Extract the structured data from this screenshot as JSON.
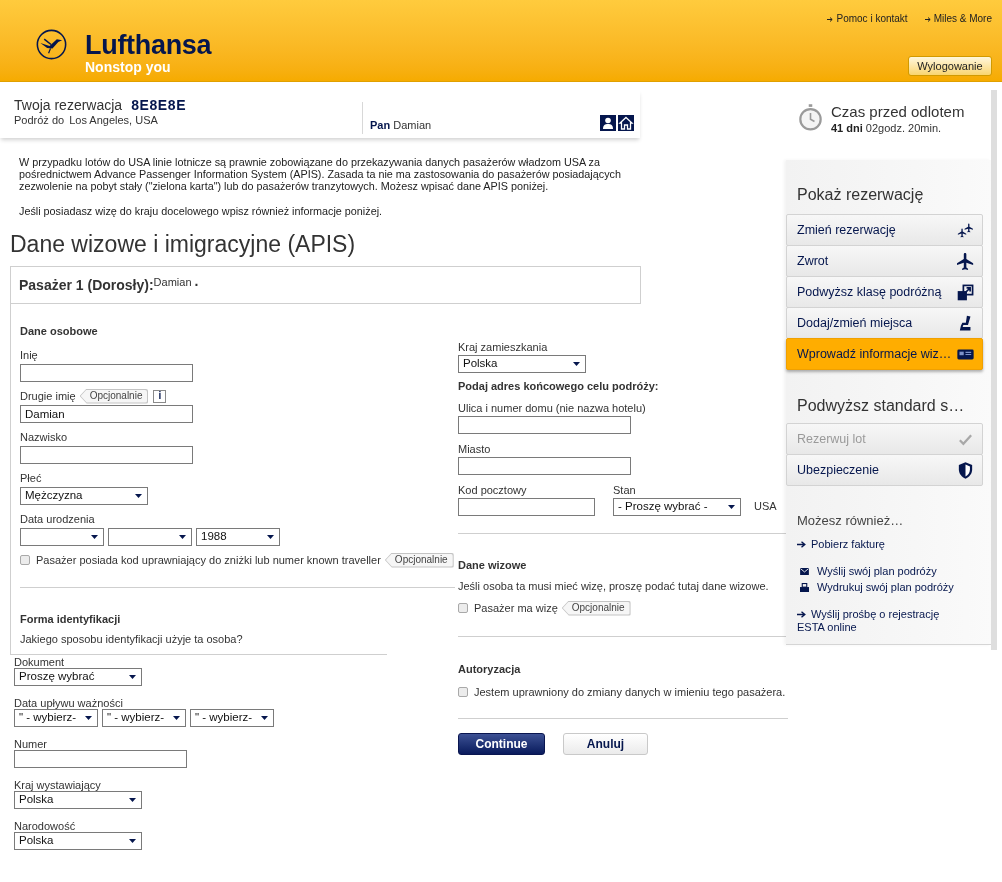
{
  "header": {
    "brand": "Lufthansa",
    "slogan": "Nonstop you",
    "links": [
      "Pomoc i kontakt",
      "Miles & More"
    ],
    "logout_button": "Wylogowanie"
  },
  "reservation": {
    "label": "Twoja rezerwacja",
    "code": "8E8E8E",
    "destination_label": "Podróż do",
    "destination": "Los Angeles, USA",
    "passenger": "**Pan** Damian"
  },
  "countdown": {
    "title": "Czas przed odlotem",
    "remaining": "**41 dni** 02godz. 20min."
  },
  "intro": [
    "W przypadku lotów do USA linie lotnicze są prawnie zobowiązane do przekazywania danych pasażerów władzom USA za pośrednictwem Advance Passenger Information System (APIS). Zasada ta nie ma zastosowania do pasażerów posiadających zezwolenie na pobyt stały (\"zielona karta\") lub do pasażerów tranzytowych. Możesz wpisać dane APIS poniżej.",
    "Jeśli posiadasz wizę do kraju docelowego wpisz również informacje poniżej."
  ],
  "page_title": "Dane wizowe i imigracyjne (APIS)",
  "passenger_panel": {
    "title": "Pasażer 1 (Dorosły):",
    "name": "Damian **.**",
    "personal": {
      "heading": "Dane osobowe",
      "fields": [
        {
          "kind": "text",
          "label": "Inię"
        },
        {
          "kind": "text",
          "label": "Drugie imię",
          "tag": "Opcjonalnie",
          "info": "i",
          "value": "Damian"
        },
        {
          "kind": "text",
          "label": "Nazwisko"
        },
        {
          "kind": "select",
          "label": "Płeć",
          "value": "Mężczyzna"
        },
        {
          "kind": "date",
          "label": "Data urodzenia",
          "parts": [
            {
              "kind": "select"
            },
            {
              "kind": "select"
            },
            {
              "kind": "select",
              "value": "1988"
            }
          ]
        }
      ],
      "checkbox": {
        "label": "Pasażer posiada kod uprawniający do zniżki lub numer known traveller",
        "checked": false,
        "tag": "Opcjonalnie"
      }
    },
    "identification": {
      "heading": "Forma identyfikacji",
      "question": "Jakiego sposobu identyfikacji użyje ta osoba?",
      "fields": [
        {
          "kind": "select",
          "label": "Dokument",
          "value": "Proszę wybrać"
        },
        {
          "kind": "date",
          "label": "Data upływu ważności",
          "parts": [
            {
              "kind": "select",
              "value": "\" - wybierz-"
            },
            {
              "kind": "select",
              "value": "\" - wybierz-"
            },
            {
              "kind": "select",
              "value": "\" - wybierz-"
            }
          ]
        },
        {
          "kind": "text",
          "label": "Numer"
        },
        {
          "kind": "select",
          "label": "Kraj wystawiający",
          "value": "Polska"
        },
        {
          "kind": "select",
          "label": "Narodowość",
          "value": "Polska"
        }
      ]
    },
    "residence": {
      "kind": "select",
      "label": "Kraj zamieszkania",
      "value": "Polska"
    },
    "address": {
      "heading": "Podaj adres końcowego celu podróży:",
      "fields": [
        {
          "kind": "text",
          "label": "Ulica i numer domu (nie nazwa hotelu)"
        },
        {
          "kind": "text",
          "label": "Miasto"
        }
      ],
      "postal": {
        "kind": "text",
        "label": "Kod pocztowy"
      },
      "state": {
        "kind": "select",
        "label": "Stan",
        "value": "- Proszę wybrać -"
      },
      "country": "USA"
    },
    "visa": {
      "heading": "Dane wizowe",
      "text": "Jeśli osoba ta musi mieć wizę, proszę podać tutaj dane wizowe.",
      "checkbox": {
        "label": "Pasażer ma wizę",
        "checked": false,
        "tag": "Opcjonalnie"
      }
    },
    "authorization": {
      "heading": "Autoryzacja",
      "checkbox": {
        "label": "Jestem uprawniony do zmiany danych w imieniu tego pasażera.",
        "checked": false
      }
    },
    "buttons": [
      {
        "kind": "primary",
        "label": "Continue"
      },
      {
        "kind": "secondary",
        "label": "Anuluj"
      }
    ]
  },
  "sidebar": {
    "sections": [
      {
        "heading": "Pokaż rezerwację",
        "items": [
          {
            "label": "Zmień rezerwację",
            "selected": false
          },
          {
            "label": "Zwrot",
            "selected": false
          },
          {
            "label": "Podwyższ klasę podróżną",
            "selected": false
          },
          {
            "label": "Dodaj/zmień miejsca",
            "selected": false
          },
          {
            "label": "Wprowadź informacje wiz…",
            "selected": true
          }
        ]
      },
      {
        "heading": "Podwyższ standard s…",
        "items": [
          {
            "label": "Rezerwuj lot",
            "selected": false,
            "disabled": true
          },
          {
            "label": "Ubezpieczenie",
            "selected": false,
            "disabled": false
          }
        ]
      }
    ],
    "more": {
      "heading": "Możesz również…",
      "links": [
        {
          "kind": "link",
          "label": "Pobierz fakturę"
        },
        {
          "kind": "email",
          "label": "Wyślij swój plan podróży"
        },
        {
          "kind": "print",
          "label": "Wydrukuj swój plan podróży"
        },
        {
          "kind": "link",
          "label": "Wyślij prośbę o rejestrację ESTA online"
        }
      ]
    }
  }
}
